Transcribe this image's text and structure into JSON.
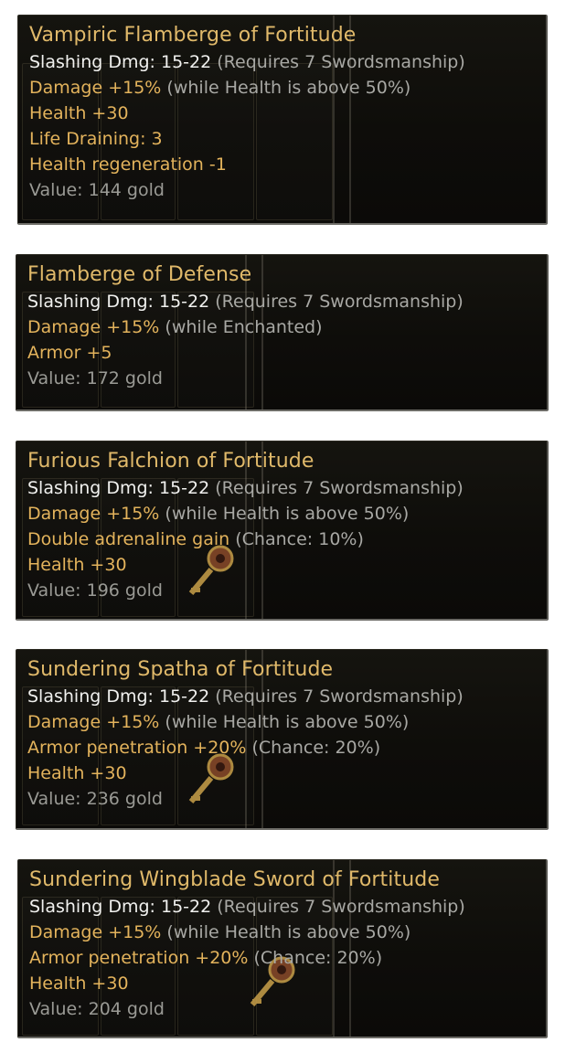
{
  "tooltips": [
    {
      "title": "Vampiric Flamberge of Fortitude",
      "lines": [
        {
          "main": "Slashing Dmg: 15-22",
          "note": "(Requires 7 Swordsmanship)",
          "kind": "white"
        },
        {
          "main": "Damage +15%",
          "note": "(while Health is above 50%)",
          "kind": "gold"
        },
        {
          "main": "Health +30",
          "note": "",
          "kind": "gold"
        },
        {
          "main": "Life Draining: 3",
          "note": "",
          "kind": "gold"
        },
        {
          "main": "Health regeneration -1",
          "note": "",
          "kind": "gold"
        },
        {
          "main": "Value: 144 gold",
          "note": "",
          "kind": "dim"
        }
      ]
    },
    {
      "title": "Flamberge of Defense",
      "lines": [
        {
          "main": "Slashing Dmg: 15-22",
          "note": "(Requires 7 Swordsmanship)",
          "kind": "white"
        },
        {
          "main": "Damage +15%",
          "note": "(while Enchanted)",
          "kind": "gold"
        },
        {
          "main": "Armor +5",
          "note": "",
          "kind": "gold"
        },
        {
          "main": "Value: 172 gold",
          "note": "",
          "kind": "dim"
        }
      ]
    },
    {
      "title": "Furious Falchion of Fortitude",
      "lines": [
        {
          "main": "Slashing Dmg: 15-22",
          "note": "(Requires 7 Swordsmanship)",
          "kind": "white"
        },
        {
          "main": "Damage +15%",
          "note": "(while Health is above 50%)",
          "kind": "gold"
        },
        {
          "main": "Double adrenaline gain",
          "note": "(Chance: 10%)",
          "kind": "gold"
        },
        {
          "main": "Health +30",
          "note": "",
          "kind": "gold"
        },
        {
          "main": "Value: 196 gold",
          "note": "",
          "kind": "dim"
        }
      ]
    },
    {
      "title": "Sundering Spatha of Fortitude",
      "lines": [
        {
          "main": "Slashing Dmg: 15-22",
          "note": "(Requires 7 Swordsmanship)",
          "kind": "white"
        },
        {
          "main": "Damage +15%",
          "note": "(while Health is above 50%)",
          "kind": "gold"
        },
        {
          "main": "Armor penetration +20%",
          "note": "(Chance: 20%)",
          "kind": "gold"
        },
        {
          "main": "Health +30",
          "note": "",
          "kind": "gold"
        },
        {
          "main": "Value: 236 gold",
          "note": "",
          "kind": "dim"
        }
      ]
    },
    {
      "title": "Sundering Wingblade Sword of Fortitude",
      "lines": [
        {
          "main": "Slashing Dmg: 15-22",
          "note": "(Requires 7 Swordsmanship)",
          "kind": "white"
        },
        {
          "main": "Damage +15%",
          "note": "(while Health is above 50%)",
          "kind": "gold"
        },
        {
          "main": "Armor penetration +20%",
          "note": "(Chance: 20%)",
          "kind": "gold"
        },
        {
          "main": "Health +30",
          "note": "",
          "kind": "gold"
        },
        {
          "main": "Value: 204 gold",
          "note": "",
          "kind": "dim"
        }
      ]
    }
  ],
  "colors": {
    "title": "#e0b96a",
    "stat_white": "#f1f1ef",
    "stat_gold": "#e3b35c",
    "note_gray": "#a8a8a4",
    "value_gray": "#9a9a95",
    "panel_bg": "#0e0d0a"
  },
  "icons": {
    "key": "key-icon",
    "sword_slot": "sword-icon"
  }
}
